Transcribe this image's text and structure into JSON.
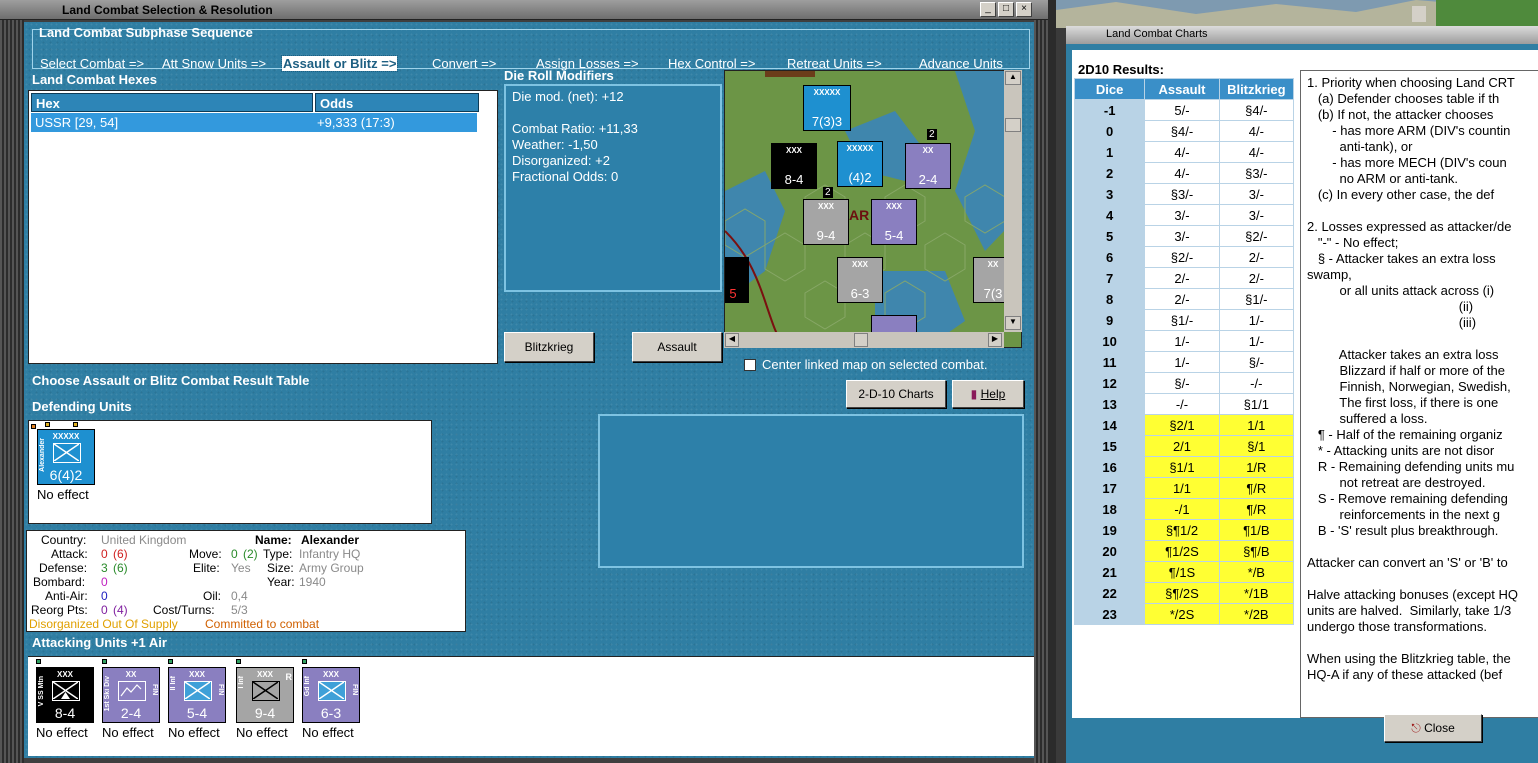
{
  "main_window": {
    "title": "Land Combat Selection & Resolution",
    "subphase": {
      "title": "Land Combat Subphase Sequence",
      "steps": [
        "Select Combat =>",
        "Att Snow Units =>",
        "Assault or Blitz =>",
        "Convert =>",
        "Assign Losses =>",
        "Hex Control =>",
        "Retreat Units =>",
        "Advance Units"
      ],
      "active_index": 2
    },
    "hexes": {
      "title": "Land Combat Hexes",
      "columns": [
        "Hex",
        "Odds"
      ],
      "rows": [
        {
          "hex": "USSR [29, 54]",
          "odds": "+9,333 (17:3)"
        }
      ]
    },
    "die_roll": {
      "title": "Die Roll Modifiers",
      "lines": [
        "Die mod. (net): +12",
        "Combat Ratio: +11,33",
        "Weather: -1,50",
        "Disorganized: +2",
        "Fractional Odds: 0"
      ]
    },
    "buttons": {
      "blitzkrieg": "Blitzkrieg",
      "assault": "Assault",
      "charts": "2-D-10 Charts",
      "help": "Help"
    },
    "center_map_label": "Center linked map on selected combat.",
    "choose_label": "Choose Assault or Blitz Combat Result Table",
    "defending_title": "Defending Units",
    "defenders": [
      {
        "size": "XXXXX",
        "side": "Alexander",
        "value": "6(4)2",
        "effect": "No effect",
        "color": "#1e90d0"
      }
    ],
    "unit_info": {
      "country_label": "Country:",
      "country": "United Kingdom",
      "name_label": "Name:",
      "name": "Alexander",
      "attack_label": "Attack:",
      "attack": "0",
      "attack_paren": "(6)",
      "move_label": "Move:",
      "move": "0",
      "move_paren": "(2)",
      "type_label": "Type:",
      "type": "Infantry HQ",
      "defense_label": "Defense:",
      "defense": "3",
      "defense_paren": "(6)",
      "elite_label": "Elite:",
      "elite": "Yes",
      "size_label": "Size:",
      "size": "Army Group",
      "bombard_label": "Bombard:",
      "bombard": "0",
      "year_label": "Year:",
      "year": "1940",
      "antiair_label": "Anti-Air:",
      "antiair": "0",
      "oil_label": "Oil:",
      "oil": "0,4",
      "reorg_label": "Reorg Pts:",
      "reorg": "0",
      "reorg_paren": "(4)",
      "cost_label": "Cost/Turns:",
      "cost": "5/3",
      "status": "Disorganized Out Of Supply",
      "status2": "Committed to combat"
    },
    "attacking_title": "Attacking Units +1 Air",
    "attackers": [
      {
        "size": "XXX",
        "side": "V SS Mtn",
        "value": "8-4",
        "effect": "No effect",
        "color": "#000000"
      },
      {
        "size": "XX",
        "side": "1st Ski Div",
        "value": "2-4",
        "effect": "No effect",
        "color": "#8a7fc0",
        "right": "FIN"
      },
      {
        "size": "XXX",
        "side": "II Inf",
        "value": "5-4",
        "effect": "No effect",
        "color": "#8a7fc0",
        "right": "FIN"
      },
      {
        "size": "XXX",
        "side": "I Inf",
        "value": "9-4",
        "effect": "No effect",
        "color": "#a5a5a5",
        "right": "R"
      },
      {
        "size": "XXX",
        "side": "Gd Inf",
        "value": "6-3",
        "effect": "No effect",
        "color": "#8a7fc0",
        "right": "FIN"
      }
    ],
    "map_counters": [
      {
        "value": "7(3)3",
        "size": "XXXXX"
      },
      {
        "value": "8-4",
        "size": "XXX"
      },
      {
        "value": "(4)2",
        "size": "XXXXX"
      },
      {
        "value": "2-4",
        "size": "XX"
      },
      {
        "value": "9-4",
        "size": "XXX"
      },
      {
        "value": "5-4",
        "size": "XXX"
      },
      {
        "value": "6-3",
        "size": "XXX"
      },
      {
        "value": "7(3",
        "size": "XX"
      },
      {
        "value": "5",
        "size": ""
      },
      {
        "value": "2",
        "size": ""
      },
      {
        "value": "2",
        "size": ""
      },
      {
        "value": "AR",
        "size": ""
      }
    ]
  },
  "charts_window": {
    "title": "Land Combat Charts",
    "results_title": "2D10 Results:",
    "columns": [
      "Dice",
      "Assault",
      "Blitzkrieg"
    ],
    "rows": [
      {
        "dice": "-1",
        "assault": "5/-",
        "blitz": "§4/-",
        "hi": false
      },
      {
        "dice": "0",
        "assault": "§4/-",
        "blitz": "4/-",
        "hi": false
      },
      {
        "dice": "1",
        "assault": "4/-",
        "blitz": "4/-",
        "hi": false
      },
      {
        "dice": "2",
        "assault": "4/-",
        "blitz": "§3/-",
        "hi": false
      },
      {
        "dice": "3",
        "assault": "§3/-",
        "blitz": "3/-",
        "hi": false
      },
      {
        "dice": "4",
        "assault": "3/-",
        "blitz": "3/-",
        "hi": false
      },
      {
        "dice": "5",
        "assault": "3/-",
        "blitz": "§2/-",
        "hi": false
      },
      {
        "dice": "6",
        "assault": "§2/-",
        "blitz": "2/-",
        "hi": false
      },
      {
        "dice": "7",
        "assault": "2/-",
        "blitz": "2/-",
        "hi": false
      },
      {
        "dice": "8",
        "assault": "2/-",
        "blitz": "§1/-",
        "hi": false
      },
      {
        "dice": "9",
        "assault": "§1/-",
        "blitz": "1/-",
        "hi": false
      },
      {
        "dice": "10",
        "assault": "1/-",
        "blitz": "1/-",
        "hi": false
      },
      {
        "dice": "11",
        "assault": "1/-",
        "blitz": "§/-",
        "hi": false
      },
      {
        "dice": "12",
        "assault": "§/-",
        "blitz": "-/-",
        "hi": false
      },
      {
        "dice": "13",
        "assault": "-/-",
        "blitz": "§1/1",
        "hi": false
      },
      {
        "dice": "14",
        "assault": "§2/1",
        "blitz": "1/1",
        "hi": true
      },
      {
        "dice": "15",
        "assault": "2/1",
        "blitz": "§/1",
        "hi": true
      },
      {
        "dice": "16",
        "assault": "§1/1",
        "blitz": "1/R",
        "hi": true
      },
      {
        "dice": "17",
        "assault": "1/1",
        "blitz": "¶/R",
        "hi": true
      },
      {
        "dice": "18",
        "assault": "-/1",
        "blitz": "¶/R",
        "hi": true
      },
      {
        "dice": "19",
        "assault": "§¶1/2",
        "blitz": "¶1/B",
        "hi": true
      },
      {
        "dice": "20",
        "assault": "¶1/2S",
        "blitz": "§¶/B",
        "hi": true
      },
      {
        "dice": "21",
        "assault": "¶/1S",
        "blitz": "*/B",
        "hi": true
      },
      {
        "dice": "22",
        "assault": "§¶/2S",
        "blitz": "*/1B",
        "hi": true
      },
      {
        "dice": "23",
        "assault": "*/2S",
        "blitz": "*/2B",
        "hi": true
      }
    ],
    "rules": [
      "1. Priority when choosing Land CRT",
      "   (a) Defender chooses table if th",
      "   (b) If not, the attacker chooses",
      "       - has more ARM (DIV's countin",
      "         anti-tank), or",
      "       - has more MECH (DIV's coun",
      "         no ARM or anti-tank.",
      "   (c) In every other case, the def",
      "",
      "2. Losses expressed as attacker/de",
      "   \"-\" - No effect;",
      "   § - Attacker takes an extra loss",
      "swamp,",
      "         or all units attack across (i)",
      "                                          (ii)",
      "                                          (iii)",
      "",
      "         Attacker takes an extra loss",
      "         Blizzard if half or more of the",
      "         Finnish, Norwegian, Swedish,",
      "         The first loss, if there is one",
      "         suffered a loss.",
      "   ¶ - Half of the remaining organiz",
      "   * - Attacking units are not disor",
      "   R - Remaining defending units mu",
      "         not retreat are destroyed.",
      "   S - Remove remaining defending",
      "         reinforcements in the next g",
      "   B - 'S' result plus breakthrough.",
      "",
      "Attacker can convert an 'S' or 'B' to",
      "",
      "Halve attacking bonuses (except HQ",
      "units are halved.  Similarly, take 1/3",
      "undergo those transformations.",
      "",
      "When using the Blitzkrieg table, the",
      "HQ-A if any of these attacked (bef"
    ],
    "close_label": "Close"
  },
  "colors": {
    "panel": "#2f7ea3",
    "highlight": "#ffff33",
    "header_blue": "#3a8fc8",
    "status_orange": "#d08000"
  }
}
